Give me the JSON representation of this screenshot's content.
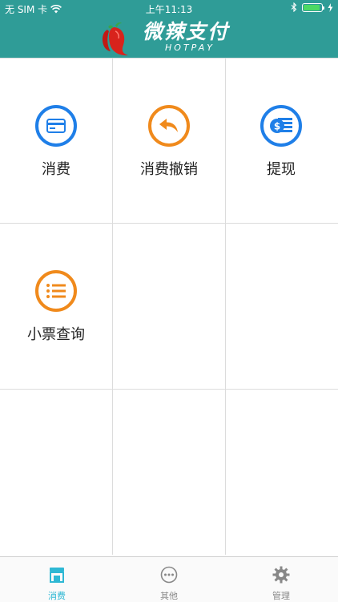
{
  "status_bar": {
    "carrier": "无 SIM 卡",
    "time": "上午11:13"
  },
  "header": {
    "title_cn": "微辣支付",
    "title_en": "HOTPAY"
  },
  "functions": [
    {
      "label": "消费",
      "icon": "card-icon",
      "color": "#1f7fe8"
    },
    {
      "label": "消费撤销",
      "icon": "undo-arrow-icon",
      "color": "#f08a1c"
    },
    {
      "label": "提现",
      "icon": "coin-stack-icon",
      "color": "#1f7fe8"
    },
    {
      "label": "小票查询",
      "icon": "list-icon",
      "color": "#f08a1c"
    }
  ],
  "tabs": [
    {
      "label": "消费",
      "icon": "store-icon",
      "active": true
    },
    {
      "label": "其他",
      "icon": "more-icon",
      "active": false
    },
    {
      "label": "管理",
      "icon": "gear-icon",
      "active": false
    }
  ],
  "colors": {
    "brand": "#2f9c97",
    "active_tab": "#2eb8d4"
  }
}
